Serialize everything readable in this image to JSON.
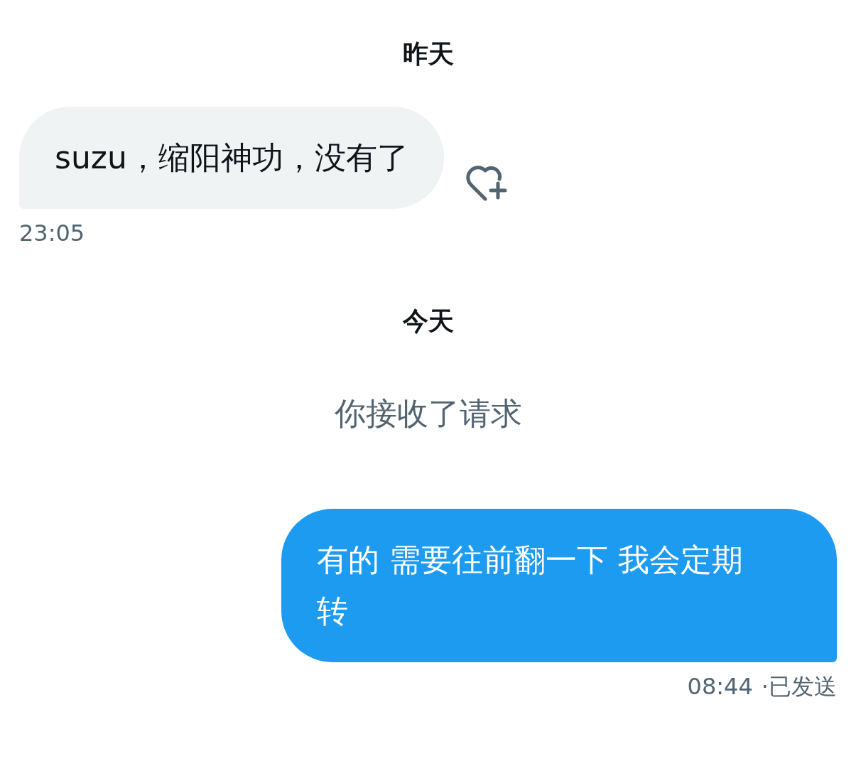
{
  "sections": [
    {
      "date": "昨天",
      "items": [
        {
          "kind": "incoming",
          "text": "suzu，缩阳神功，没有了",
          "time": "23:05",
          "react_button": true
        }
      ]
    },
    {
      "date": "今天",
      "items": [
        {
          "kind": "system",
          "text": "你接收了请求"
        },
        {
          "kind": "outgoing",
          "text": "有的 需要往前翻一下 我会定期转",
          "time": "08:44",
          "status": "·已发送"
        }
      ]
    }
  ]
}
